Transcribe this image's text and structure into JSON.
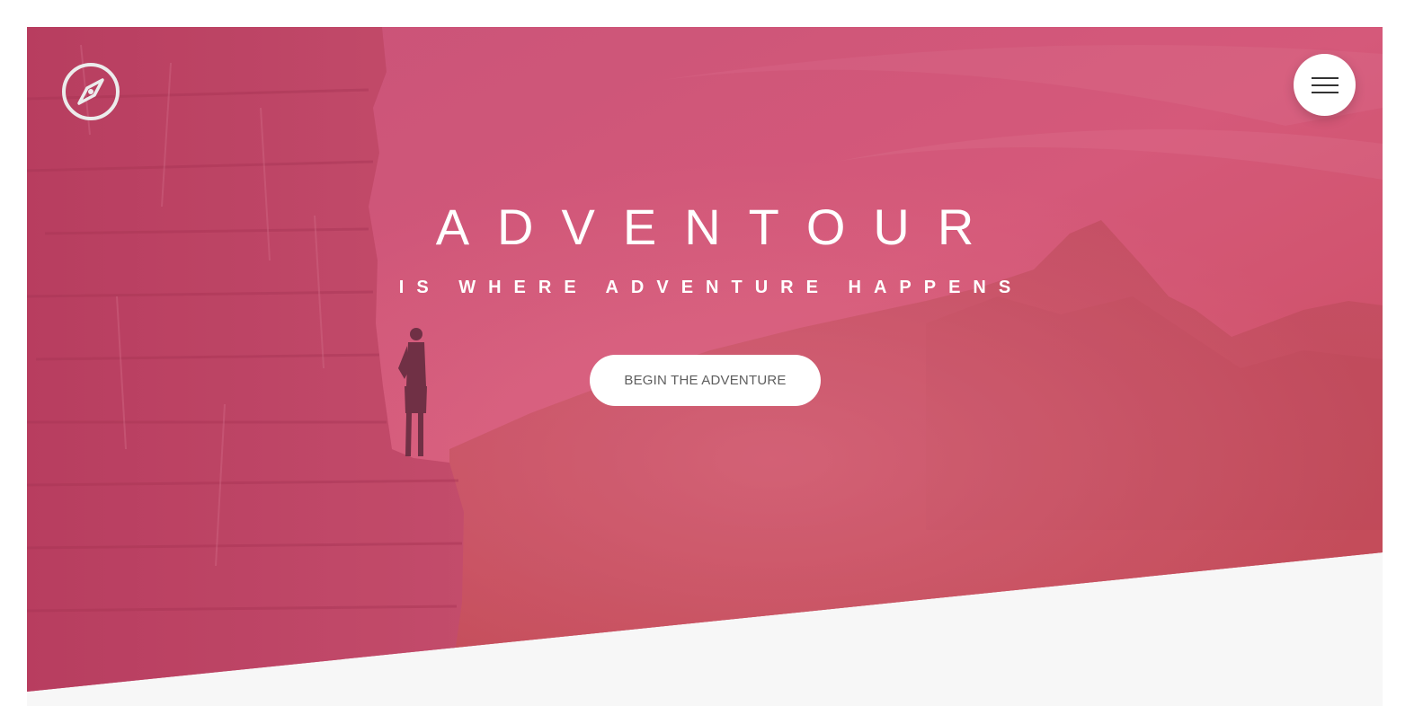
{
  "hero": {
    "title": "ADVENTOUR",
    "subtitle": "IS WHERE ADVENTURE HAPPENS",
    "cta_label": "BEGIN THE ADVENTURE",
    "overlay_color": "#d4507a"
  },
  "header": {
    "logo_icon": "compass-icon",
    "menu_icon": "hamburger-menu-icon"
  },
  "colors": {
    "overlay": "#d4507a",
    "button_bg": "#ffffff",
    "button_text": "#5e5e5e",
    "below_fold_bg": "#f7f7f7"
  }
}
